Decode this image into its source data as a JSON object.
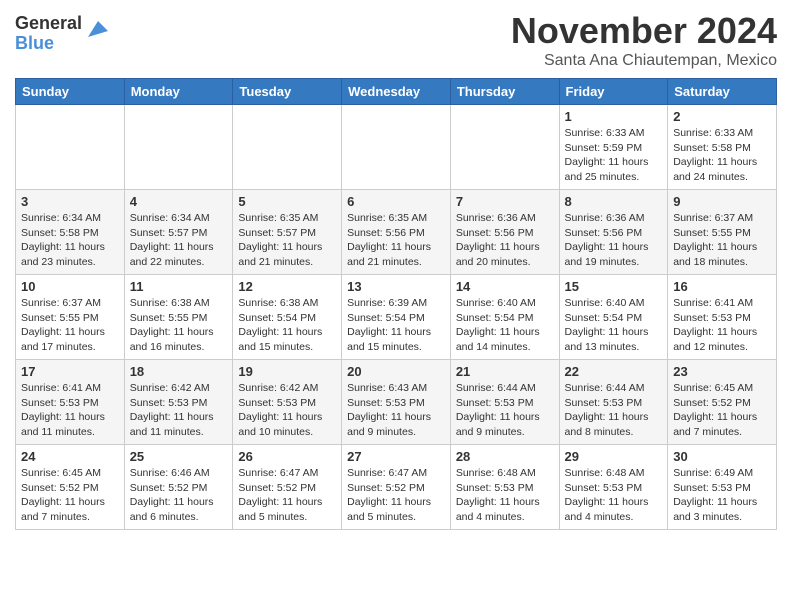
{
  "logo": {
    "line1": "General",
    "line2": "Blue"
  },
  "title": "November 2024",
  "location": "Santa Ana Chiautempan, Mexico",
  "weekdays": [
    "Sunday",
    "Monday",
    "Tuesday",
    "Wednesday",
    "Thursday",
    "Friday",
    "Saturday"
  ],
  "weeks": [
    [
      {
        "day": "",
        "info": ""
      },
      {
        "day": "",
        "info": ""
      },
      {
        "day": "",
        "info": ""
      },
      {
        "day": "",
        "info": ""
      },
      {
        "day": "",
        "info": ""
      },
      {
        "day": "1",
        "info": "Sunrise: 6:33 AM\nSunset: 5:59 PM\nDaylight: 11 hours\nand 25 minutes."
      },
      {
        "day": "2",
        "info": "Sunrise: 6:33 AM\nSunset: 5:58 PM\nDaylight: 11 hours\nand 24 minutes."
      }
    ],
    [
      {
        "day": "3",
        "info": "Sunrise: 6:34 AM\nSunset: 5:58 PM\nDaylight: 11 hours\nand 23 minutes."
      },
      {
        "day": "4",
        "info": "Sunrise: 6:34 AM\nSunset: 5:57 PM\nDaylight: 11 hours\nand 22 minutes."
      },
      {
        "day": "5",
        "info": "Sunrise: 6:35 AM\nSunset: 5:57 PM\nDaylight: 11 hours\nand 21 minutes."
      },
      {
        "day": "6",
        "info": "Sunrise: 6:35 AM\nSunset: 5:56 PM\nDaylight: 11 hours\nand 21 minutes."
      },
      {
        "day": "7",
        "info": "Sunrise: 6:36 AM\nSunset: 5:56 PM\nDaylight: 11 hours\nand 20 minutes."
      },
      {
        "day": "8",
        "info": "Sunrise: 6:36 AM\nSunset: 5:56 PM\nDaylight: 11 hours\nand 19 minutes."
      },
      {
        "day": "9",
        "info": "Sunrise: 6:37 AM\nSunset: 5:55 PM\nDaylight: 11 hours\nand 18 minutes."
      }
    ],
    [
      {
        "day": "10",
        "info": "Sunrise: 6:37 AM\nSunset: 5:55 PM\nDaylight: 11 hours\nand 17 minutes."
      },
      {
        "day": "11",
        "info": "Sunrise: 6:38 AM\nSunset: 5:55 PM\nDaylight: 11 hours\nand 16 minutes."
      },
      {
        "day": "12",
        "info": "Sunrise: 6:38 AM\nSunset: 5:54 PM\nDaylight: 11 hours\nand 15 minutes."
      },
      {
        "day": "13",
        "info": "Sunrise: 6:39 AM\nSunset: 5:54 PM\nDaylight: 11 hours\nand 15 minutes."
      },
      {
        "day": "14",
        "info": "Sunrise: 6:40 AM\nSunset: 5:54 PM\nDaylight: 11 hours\nand 14 minutes."
      },
      {
        "day": "15",
        "info": "Sunrise: 6:40 AM\nSunset: 5:54 PM\nDaylight: 11 hours\nand 13 minutes."
      },
      {
        "day": "16",
        "info": "Sunrise: 6:41 AM\nSunset: 5:53 PM\nDaylight: 11 hours\nand 12 minutes."
      }
    ],
    [
      {
        "day": "17",
        "info": "Sunrise: 6:41 AM\nSunset: 5:53 PM\nDaylight: 11 hours\nand 11 minutes."
      },
      {
        "day": "18",
        "info": "Sunrise: 6:42 AM\nSunset: 5:53 PM\nDaylight: 11 hours\nand 11 minutes."
      },
      {
        "day": "19",
        "info": "Sunrise: 6:42 AM\nSunset: 5:53 PM\nDaylight: 11 hours\nand 10 minutes."
      },
      {
        "day": "20",
        "info": "Sunrise: 6:43 AM\nSunset: 5:53 PM\nDaylight: 11 hours\nand 9 minutes."
      },
      {
        "day": "21",
        "info": "Sunrise: 6:44 AM\nSunset: 5:53 PM\nDaylight: 11 hours\nand 9 minutes."
      },
      {
        "day": "22",
        "info": "Sunrise: 6:44 AM\nSunset: 5:53 PM\nDaylight: 11 hours\nand 8 minutes."
      },
      {
        "day": "23",
        "info": "Sunrise: 6:45 AM\nSunset: 5:52 PM\nDaylight: 11 hours\nand 7 minutes."
      }
    ],
    [
      {
        "day": "24",
        "info": "Sunrise: 6:45 AM\nSunset: 5:52 PM\nDaylight: 11 hours\nand 7 minutes."
      },
      {
        "day": "25",
        "info": "Sunrise: 6:46 AM\nSunset: 5:52 PM\nDaylight: 11 hours\nand 6 minutes."
      },
      {
        "day": "26",
        "info": "Sunrise: 6:47 AM\nSunset: 5:52 PM\nDaylight: 11 hours\nand 5 minutes."
      },
      {
        "day": "27",
        "info": "Sunrise: 6:47 AM\nSunset: 5:52 PM\nDaylight: 11 hours\nand 5 minutes."
      },
      {
        "day": "28",
        "info": "Sunrise: 6:48 AM\nSunset: 5:53 PM\nDaylight: 11 hours\nand 4 minutes."
      },
      {
        "day": "29",
        "info": "Sunrise: 6:48 AM\nSunset: 5:53 PM\nDaylight: 11 hours\nand 4 minutes."
      },
      {
        "day": "30",
        "info": "Sunrise: 6:49 AM\nSunset: 5:53 PM\nDaylight: 11 hours\nand 3 minutes."
      }
    ]
  ]
}
